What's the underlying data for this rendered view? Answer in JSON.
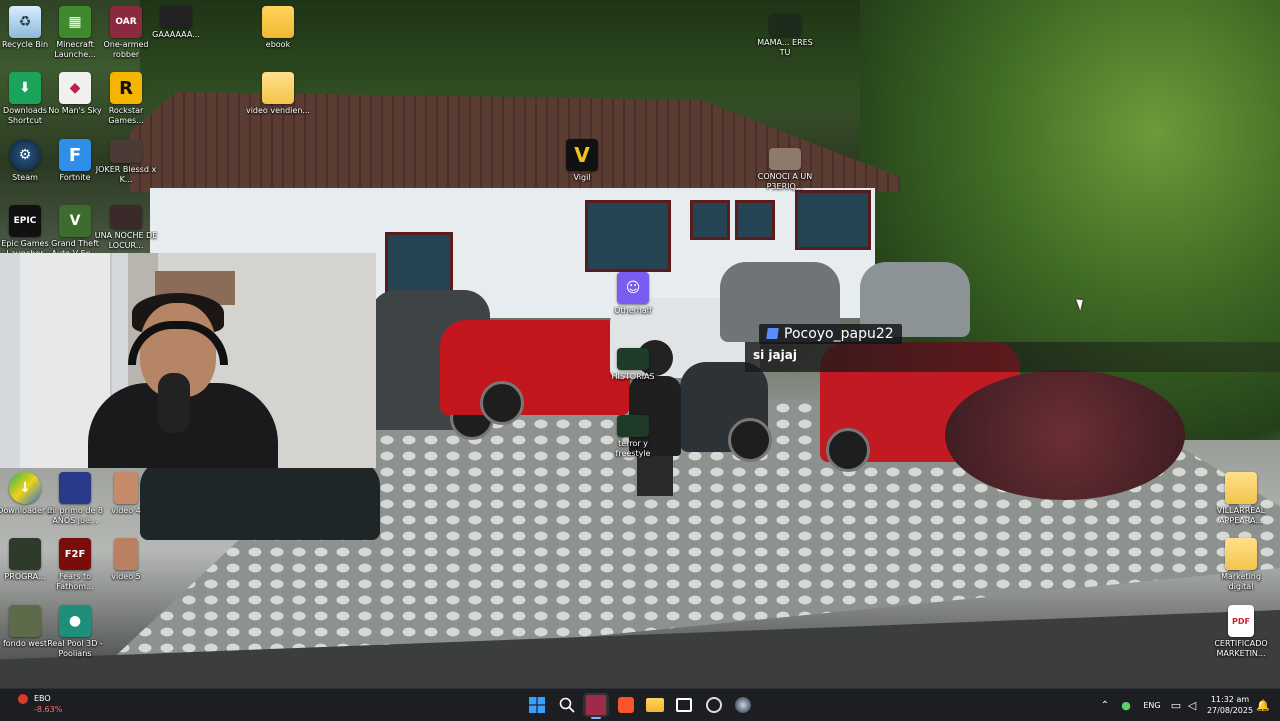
{
  "desktop_icons": {
    "recycle_bin": "Recycle Bin",
    "minecraft": "Minecraft Launche...",
    "one_armed": "One-armed robber",
    "gaaaa": "GAAAAAA...",
    "ebook": "ebook",
    "mama": "MAMA... ERES TU",
    "downloads": "Downloads Shortcut",
    "no_mans_sky": "No Man's Sky",
    "rockstar": "Rockstar Games...",
    "video_vendien": "video vendien...",
    "steam": "Steam",
    "fortnite": "Fortnite",
    "joker": "JOKER Blessd x K...",
    "vigil": "Vigil",
    "conoci": "CONOCI A UN P3ERIQ...",
    "epic": "Epic Games Launcher",
    "gta": "Grand Theft Auto V En...",
    "una_noche": "UNA NOCHE DE LOCUR...",
    "otherhalf": "Otherhalf",
    "historias": "HISTORIAS",
    "terror": "terror y freestyle",
    "downloader": "Downloader 2",
    "mi_primo": "mi primo de 8 AÑOS jue...",
    "video4": "video 4",
    "progra": "PROGRA...",
    "fears": "Fears to Fathom...",
    "video5": "video 5",
    "fondo_west": "fondo west",
    "real_pool": "Real Pool 3D - Poolians",
    "villarreal": "VILLARREAL APPEARA...",
    "marketing": "Marketing digital",
    "certificado": "CERTIFICADO MARKETIN...",
    "epic_glyph": "EPIC",
    "f2f_glyph": "F2F",
    "fortnite_glyph": "F",
    "rockstar_glyph": "R",
    "vigil_glyph": "V",
    "pdf_glyph": "PDF"
  },
  "chat": {
    "username": "Pocoyo_papu22",
    "message": "si jajaj"
  },
  "taskbar": {
    "stock_name": "EBO",
    "stock_change": "-8.63%",
    "language": "ENG",
    "time": "11:32 am",
    "date": "27/08/2025"
  },
  "colors": {
    "taskbar_bg": "#1c1e22",
    "start_blue": "#3aa0ff",
    "twitch_purple": "#5a8cff",
    "stock_down": "#ff6b6b"
  }
}
